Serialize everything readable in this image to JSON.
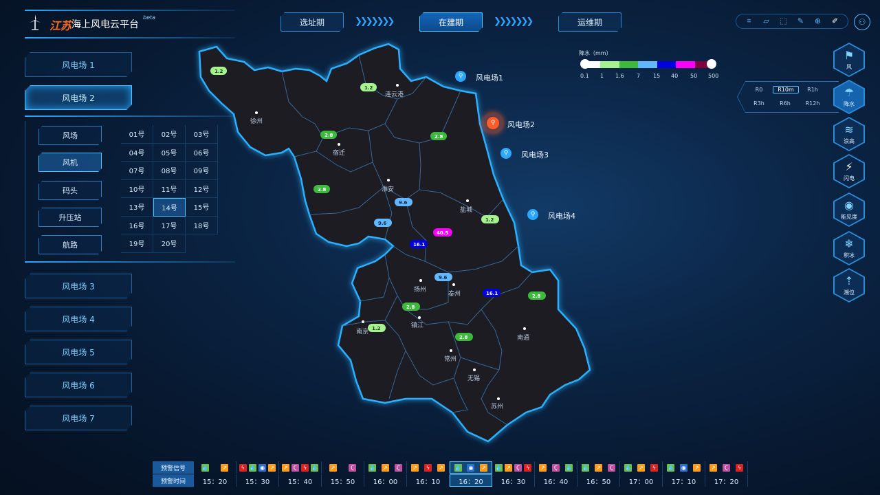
{
  "brand": {
    "province": "江苏",
    "name": "海上风电云平台",
    "beta": "beta"
  },
  "phases": [
    "选址期",
    "在建期",
    "运维期"
  ],
  "active_phase": "在建期",
  "toolbar": {
    "icons": [
      "crop-icon",
      "polygon-icon",
      "select-icon",
      "brush-icon",
      "zoom-icon",
      "edit-icon"
    ]
  },
  "farms": [
    "风电场 1",
    "风电场 2",
    "风电场 3",
    "风电场 4",
    "风电场 5",
    "风电场 6",
    "风电场 7"
  ],
  "active_farm": "风电场 2",
  "categories": [
    "风场",
    "风机",
    "码头",
    "升压站",
    "航路"
  ],
  "active_category": "风机",
  "turbines": [
    "01号",
    "02号",
    "03号",
    "04号",
    "05号",
    "06号",
    "07号",
    "08号",
    "09号",
    "10号",
    "11号",
    "12号",
    "13号",
    "14号",
    "15号",
    "16号",
    "17号",
    "18号",
    "19号",
    "20号"
  ],
  "active_turbine": "14号",
  "map": {
    "cities": [
      "徐州",
      "连云港",
      "宿迁",
      "淮安",
      "盐城",
      "扬州",
      "泰州",
      "南京",
      "镇江",
      "南通",
      "常州",
      "无锡",
      "苏州"
    ],
    "wind_farms": [
      "风电场1",
      "风电场2",
      "风电场3",
      "风电场4"
    ],
    "rain_values": [
      "1.2",
      "1.2",
      "2.8",
      "2.8",
      "2.8",
      "9.6",
      "9.6",
      "40.5",
      "16.1",
      "1.2",
      "9.6",
      "16.1",
      "2.8",
      "2.8",
      "1.2",
      "2.8"
    ]
  },
  "legend": {
    "title": "降水（mm）",
    "ticks": [
      "0.1",
      "1",
      "1.6",
      "7",
      "15",
      "40",
      "50",
      "500"
    ],
    "colors": [
      "#ffffff",
      "#a6f28f",
      "#3dba3d",
      "#61b8ff",
      "#0000e1",
      "#fa00fa",
      "#800040"
    ]
  },
  "right_panel": {
    "items": [
      {
        "label": "风",
        "icon": "wind-icon"
      },
      {
        "label": "降水",
        "icon": "rain-icon"
      },
      {
        "label": "浪高",
        "icon": "wave-icon"
      },
      {
        "label": "闪电",
        "icon": "lightning-icon"
      },
      {
        "label": "能见度",
        "icon": "eye-icon"
      },
      {
        "label": "积冰",
        "icon": "snowflake-icon"
      },
      {
        "label": "潮位",
        "icon": "tide-icon"
      }
    ],
    "rain_options": [
      "R0",
      "R10m",
      "R1h",
      "R3h",
      "R6h",
      "R12h"
    ],
    "active_rain_option": "R10m"
  },
  "timeline": {
    "row_labels": [
      "预警信号",
      "预警时间"
    ],
    "times": [
      "15：20",
      "15：30",
      "15：40",
      "15：50",
      "16：00",
      "16：10",
      "16：20",
      "16：30",
      "16：40",
      "16：50",
      "17：00",
      "17：10",
      "17：20"
    ],
    "active_time": "16：20"
  }
}
